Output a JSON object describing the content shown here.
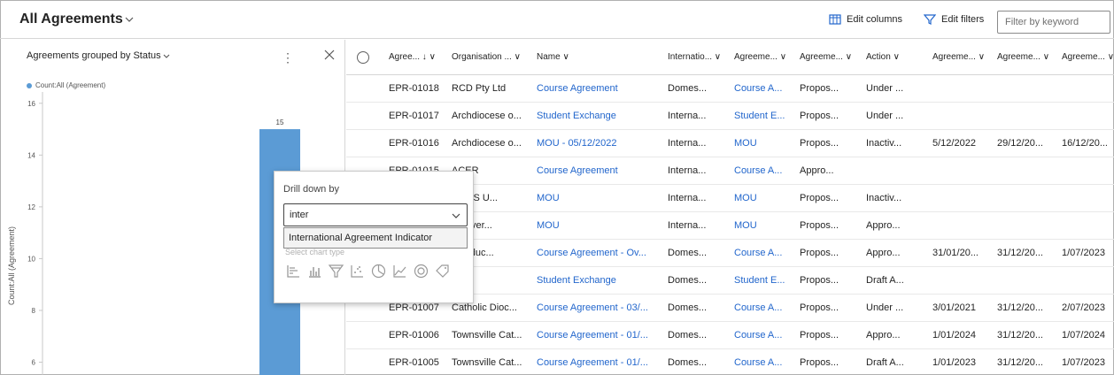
{
  "header": {
    "view_title": "All Agreements",
    "edit_columns": "Edit columns",
    "edit_filters": "Edit filters",
    "filter_placeholder": "Filter by keyword"
  },
  "chart": {
    "title": "Agreements grouped by Status",
    "legend": "Count:All (Agreement)",
    "ylabel": "Count:All (Agreement)"
  },
  "chart_data": {
    "type": "bar",
    "title": "Agreements grouped by Status",
    "ylabel": "Count:All (Agreement)",
    "series": [
      {
        "name": "Count:All (Agreement)",
        "values": [
          15
        ]
      }
    ],
    "value_labels": [
      "15"
    ],
    "yticks": [
      6,
      8,
      10,
      12,
      14,
      16
    ],
    "ylim": [
      5.3,
      16.3
    ],
    "grid": true,
    "legend_position": "top-left"
  },
  "drilldown": {
    "title": "Drill down by",
    "input_value": "inter",
    "option": "International Agreement Indicator",
    "chart_type_label": "Select chart type",
    "chart_types": [
      "bar-icon",
      "column-icon",
      "funnel-icon",
      "scatter-icon",
      "pie-icon",
      "line-icon",
      "donut-icon",
      "tag-icon"
    ]
  },
  "grid": {
    "columns": [
      "Agree...",
      "Organisation ...",
      "Name",
      "Internatio...",
      "Agreeme...",
      "Agreeme...",
      "Action",
      "Agreeme...",
      "Agreeme...",
      "Agreeme..."
    ],
    "rows": [
      [
        "EPR-01018",
        "RCD Pty Ltd",
        "Course Agreement",
        "Domes...",
        "Course A...",
        "Propos...",
        "Under ...",
        "",
        "",
        ""
      ],
      [
        "EPR-01017",
        "Archdiocese o...",
        "Student Exchange",
        "Interna...",
        "Student E...",
        "Propos...",
        "Under ...",
        "",
        "",
        ""
      ],
      [
        "EPR-01016",
        "Archdiocese o...",
        "MOU - 05/12/2022",
        "Interna...",
        "MOU",
        "Propos...",
        "Inactiv...",
        "5/12/2022",
        "29/12/20...",
        "16/12/20..."
      ],
      [
        "EPR-01015",
        "ACER",
        "Course Agreement",
        "Interna...",
        "Course A...",
        "Appro...",
        "",
        "",
        "",
        ""
      ],
      [
        "",
        "HAMS U...",
        "MOU",
        "Interna...",
        "MOU",
        "Propos...",
        "Inactiv...",
        "",
        "",
        ""
      ],
      [
        "",
        "l Univer...",
        "MOU",
        "Interna...",
        "MOU",
        "Propos...",
        "Appro...",
        "",
        "",
        ""
      ],
      [
        "",
        "lic Educ...",
        "Course Agreement - Ov...",
        "Domes...",
        "Course A...",
        "Propos...",
        "Appro...",
        "31/01/20...",
        "31/12/20...",
        "1/07/2023"
      ],
      [
        "",
        "",
        "Student Exchange",
        "Domes...",
        "Student E...",
        "Propos...",
        "Draft A...",
        "",
        "",
        ""
      ],
      [
        "EPR-01007",
        "Catholic Dioc...",
        "Course Agreement - 03/...",
        "Domes...",
        "Course A...",
        "Propos...",
        "Under ...",
        "3/01/2021",
        "31/12/20...",
        "2/07/2023"
      ],
      [
        "EPR-01006",
        "Townsville Cat...",
        "Course Agreement - 01/...",
        "Domes...",
        "Course A...",
        "Propos...",
        "Appro...",
        "1/01/2024",
        "31/12/20...",
        "1/07/2024"
      ],
      [
        "EPR-01005",
        "Townsville Cat...",
        "Course Agreement - 01/...",
        "Domes...",
        "Course A...",
        "Propos...",
        "Draft A...",
        "1/01/2023",
        "31/12/20...",
        "1/07/2023"
      ]
    ]
  }
}
